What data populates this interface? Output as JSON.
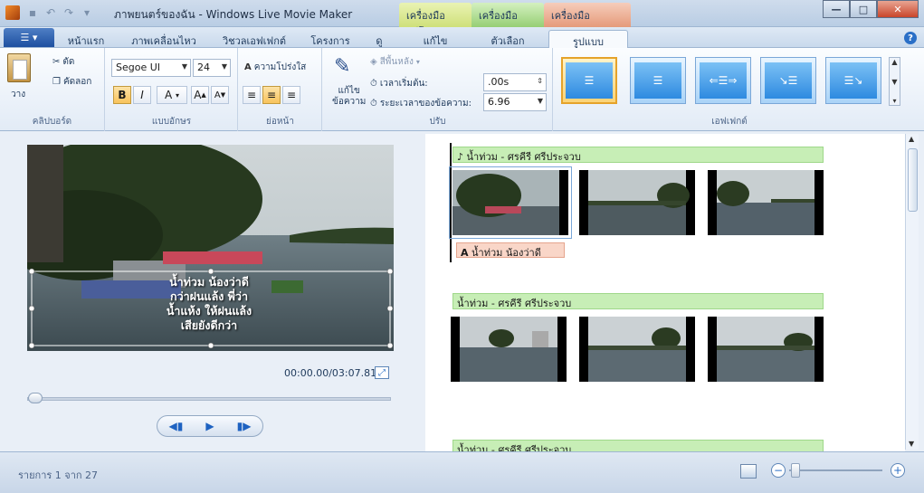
{
  "window": {
    "title": "ภาพยนตร์ของฉัน - Windows Live Movie Maker",
    "contextual_tabs": {
      "video_tools": "เครื่องมือวิดีโอ",
      "music_tools": "เครื่องมือเพลง",
      "text_tools": "เครื่องมือข้อความ"
    },
    "controls": {
      "minimize": "—",
      "maximize": "□",
      "close": "✕"
    }
  },
  "tabs": {
    "file_icon": "menu-icon",
    "items": [
      "หน้าแรก",
      "ภาพเคลื่อนไหว",
      "วิชวลเอฟเฟกต์",
      "โครงการ",
      "ดู",
      "แก้ไข",
      "ตัวเลือก",
      "รูปแบบ"
    ],
    "active": "รูปแบบ"
  },
  "ribbon": {
    "clipboard": {
      "paste": "วาง",
      "cut": "ตัด",
      "copy": "คัดลอก",
      "label": "คลิปบอร์ด"
    },
    "font": {
      "family": "Segoe UI",
      "size": "24",
      "bold": "B",
      "italic": "I",
      "color": "A",
      "grow": "A",
      "shrink": "A",
      "label": "แบบอักษร"
    },
    "paragraph": {
      "transparency": "ความโปร่งใส",
      "label": "ย่อหน้า"
    },
    "adjust": {
      "edit_text": [
        "แก้ไข",
        "ข้อความ"
      ],
      "background_color": "สีพื้นหลัง",
      "start_time_label": "เวลาเริ่มต้น:",
      "start_time": ".00s",
      "duration_label": "ระยะเวลาของข้อความ:",
      "duration": "6.96",
      "label": "ปรับ"
    },
    "effects": {
      "label": "เอฟเฟกต์",
      "selected_index": 0
    }
  },
  "preview": {
    "caption_lines": [
      "น้ำท่วม น้องว่าดี",
      "กว่าฝนแล้ง พี่ว่า",
      "น้ำแห้ง ให้ฝนแล้ง",
      "เสียยังดีกว่า"
    ],
    "timecode": "00:00.00/03:07.81",
    "seek_position": 0
  },
  "storyboard": {
    "rows": [
      {
        "music": "น้ำท่วม - ศรคีรี ศรีประจวบ",
        "caption": "น้ำท่วม น้องว่าดี"
      },
      {
        "music": "น้ำท่วม - ศรคีรี ศรีประจวบ"
      },
      {
        "music": "น้ำท่วม - ศรคีรี ศรีประจวบ"
      }
    ]
  },
  "status": {
    "text": "รายการ 1 จาก 27",
    "zoom_level": 0.05
  }
}
